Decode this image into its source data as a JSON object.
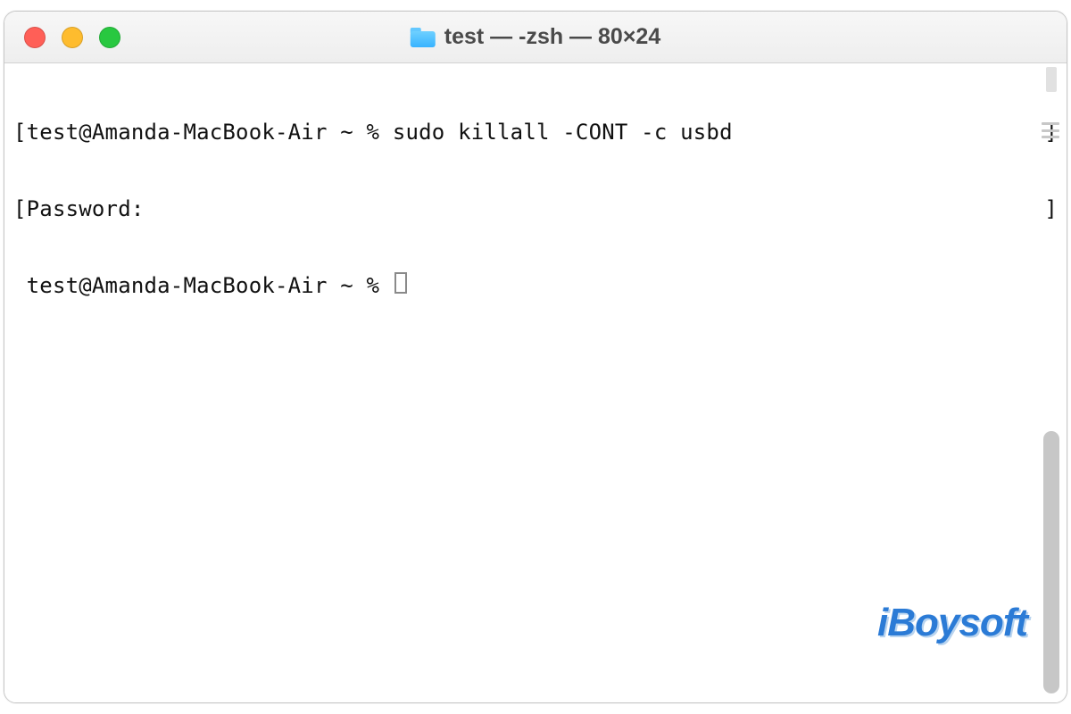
{
  "window": {
    "title": "test — -zsh — 80×24"
  },
  "terminal": {
    "lines": [
      {
        "left": "[",
        "text": "test@Amanda-MacBook-Air ~ % sudo killall -CONT -c usbd",
        "right": "]"
      },
      {
        "left": "[",
        "text": "Password:",
        "right": "]"
      },
      {
        "left": " ",
        "text": "test@Amanda-MacBook-Air ~ % ",
        "cursor": true,
        "right": ""
      }
    ]
  },
  "watermark": "iBoysoft"
}
